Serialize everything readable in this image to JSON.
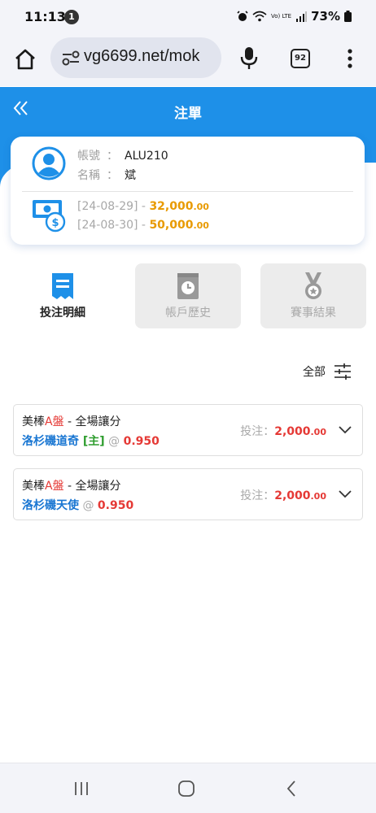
{
  "status_bar": {
    "time": "11:13",
    "notification_count": "1",
    "network": "Vo) LTE",
    "battery": "73%"
  },
  "browser": {
    "url": "vg6699.net/mok",
    "tab_count": "92"
  },
  "header": {
    "title": "注單"
  },
  "account": {
    "account_label": "帳號",
    "account_value": "ALU210",
    "name_label": "名稱",
    "name_value": "斌",
    "separator": "：",
    "balances": [
      {
        "date": "[24-08-29]",
        "dash": " - ",
        "amount": "32,000",
        "cents": ".00"
      },
      {
        "date": "[24-08-30]",
        "dash": " - ",
        "amount": "50,000",
        "cents": ".00"
      }
    ]
  },
  "tabs": [
    {
      "label": "投注明細",
      "icon": "receipt-icon",
      "active": true
    },
    {
      "label": "帳戶歷史",
      "icon": "clock-book-icon",
      "active": false
    },
    {
      "label": "賽事結果",
      "icon": "medal-icon",
      "active": false
    }
  ],
  "filter": {
    "label": "全部",
    "icon": "sliders-icon"
  },
  "bets": [
    {
      "sport": "美棒",
      "plate": "A盤",
      "market": " - 全場讓分",
      "team": "洛杉磯道奇",
      "home_tag": " [主]",
      "at": " @ ",
      "odds": "0.950",
      "stake_label": "投注：",
      "stake": "2,000",
      "stake_cents": ".00"
    },
    {
      "sport": "美棒",
      "plate": "A盤",
      "market": " - 全場讓分",
      "team": "洛杉磯天使",
      "home_tag": "",
      "at": " @ ",
      "odds": "0.950",
      "stake_label": "投注：",
      "stake": "2,000",
      "stake_cents": ".00"
    }
  ],
  "colors": {
    "brand_blue": "#1e90e8",
    "amount_orange": "#e89a00",
    "odds_red": "#e53935",
    "team_blue": "#1976d2",
    "home_green": "#2e9d2e"
  }
}
